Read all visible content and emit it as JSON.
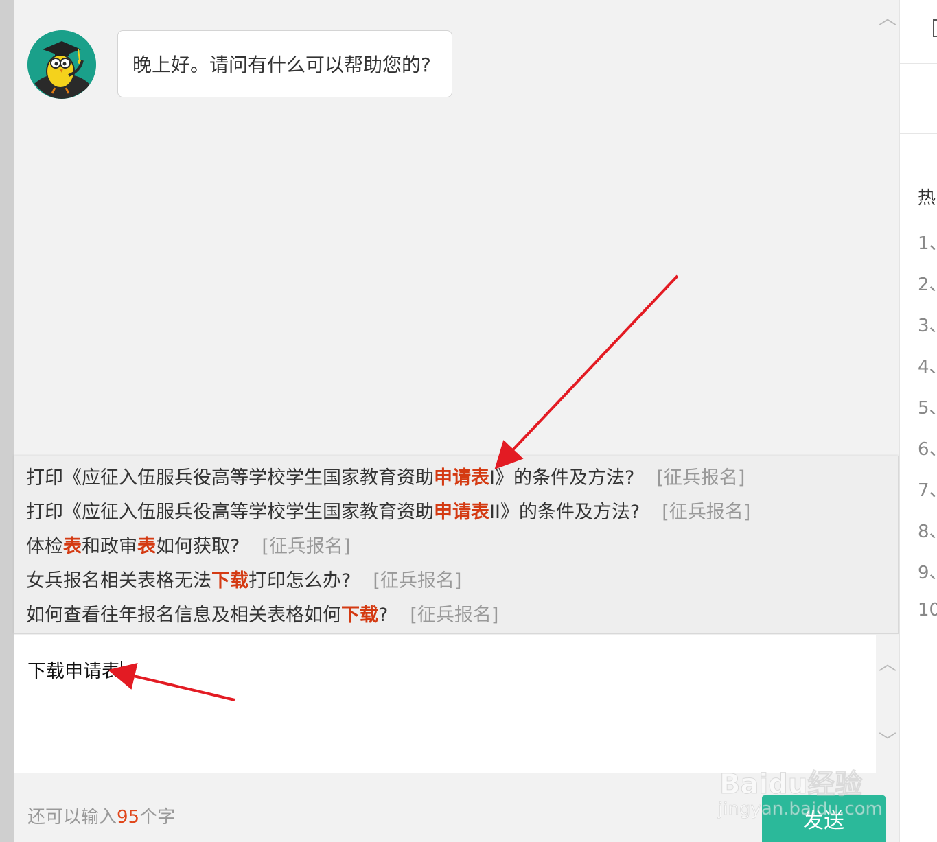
{
  "chat": {
    "bot_message": "晚上好。请问有什么可以帮助您的?"
  },
  "suggestions": [
    {
      "pre": "打印《应征入伍服兵役高等学校学生国家教育资助",
      "hl": "申请表",
      "post": "I》的条件及方法?",
      "tag": "[征兵报名]"
    },
    {
      "pre": "打印《应征入伍服兵役高等学校学生国家教育资助",
      "hl": "申请表",
      "post": "II》的条件及方法?",
      "tag": "[征兵报名]"
    },
    {
      "pre": "体检",
      "hl": "表",
      "mid": "和政审",
      "hl2": "表",
      "post": "如何获取?",
      "tag": "[征兵报名]"
    },
    {
      "pre": "女兵报名相关表格无法",
      "hl": "下载",
      "post": "打印怎么办?",
      "tag": "[征兵报名]"
    },
    {
      "pre": "如何查看往年报名信息及相关表格如何",
      "hl": "下载",
      "post": "?",
      "tag": "[征兵报名]"
    }
  ],
  "input": {
    "value": "下载申请表"
  },
  "footer": {
    "counter_prefix": "还可以输入",
    "counter_num": "95",
    "counter_suffix": "个字",
    "send_label": "发送"
  },
  "right_panel": {
    "title": "热",
    "numbers": [
      "1、",
      "2、",
      "3、",
      "4、",
      "5、",
      "6、",
      "7、",
      "8、",
      "9、",
      "10"
    ]
  },
  "watermark": {
    "brand": "Baidu经验",
    "url": "jingyan.baidu.com"
  },
  "colors": {
    "highlight": "#d43a12",
    "send_button": "#2bb99a",
    "counter_num": "#e0461a",
    "annotation_arrow": "#e31b23"
  }
}
